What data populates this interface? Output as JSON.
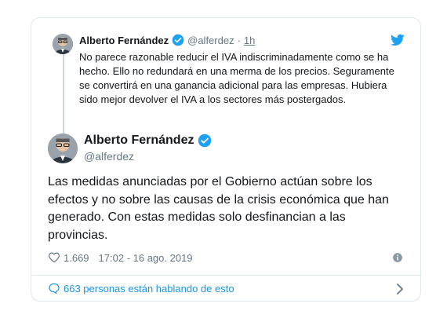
{
  "colors": {
    "text": "#14171a",
    "muted": "#657786",
    "accent": "#1da1f2",
    "link": "#1b95e0",
    "border": "#e1e8ed"
  },
  "parent_tweet": {
    "author_name": "Alberto Fernández",
    "handle": "@alferdez",
    "separator": "·",
    "time": "1h",
    "text": "No parece razonable reducir el IVA indiscriminadamente como se ha hecho. Ello no redundará en una merma de los precios. Seguramente se convertirá en una ganancia adicional para las empresas. Hubiera sido mejor devolver el IVA a los sectores más postergados.",
    "icons": [
      "verified-badge-icon",
      "twitter-bird-icon"
    ]
  },
  "main_tweet": {
    "author_name": "Alberto Fernández",
    "handle": "@alferdez",
    "text": "Las medidas anunciadas por el Gobierno actúan sobre los efectos y no sobre las causas de la crisis económica que han generado. Con estas medidas solo desfinancian a las provincias.",
    "likes": "1.669",
    "timestamp": "17:02 - 16 ago. 2019",
    "icons": [
      "verified-badge-icon",
      "heart-icon",
      "info-icon"
    ]
  },
  "footer": {
    "conversation_label": "663 personas están hablando de esto",
    "icons": [
      "comment-bubble-icon",
      "chevron-right-icon"
    ]
  }
}
